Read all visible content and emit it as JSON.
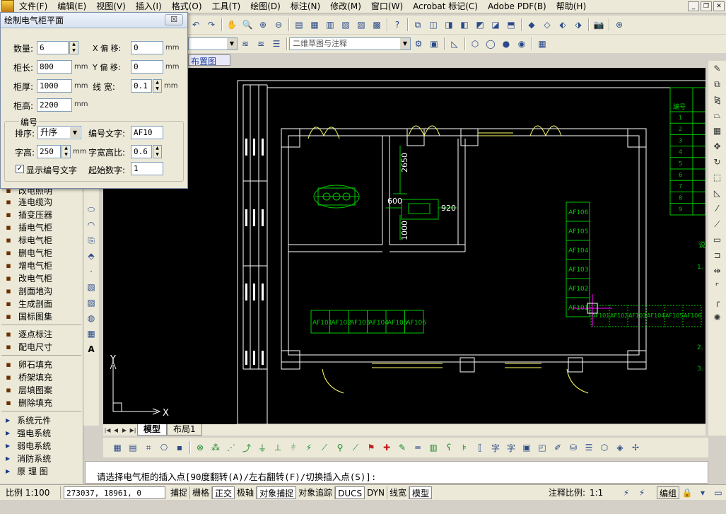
{
  "menu": [
    "文件(F)",
    "编辑(E)",
    "视图(V)",
    "插入(I)",
    "格式(O)",
    "工具(T)",
    "绘图(D)",
    "标注(N)",
    "修改(M)",
    "窗口(W)",
    "Acrobat 标记(C)",
    "Adobe PDF(B)",
    "帮助(H)"
  ],
  "toolbar": {
    "workspace_combo": "二维草图与注释",
    "layout_tab_hint": "布置图"
  },
  "dialog": {
    "title": "绘制电气柜平面",
    "close_label": "☒",
    "count_label": "数量:",
    "count_value": "6",
    "length_label": "柜长:",
    "length_value": "800",
    "thickness_label": "柜厚:",
    "thickness_value": "1000",
    "height_label": "柜高:",
    "height_value": "2200",
    "unit_mm": "mm",
    "x_offset_label": "X 偏 移:",
    "x_offset_value": "0",
    "y_offset_label": "Y 偏 移:",
    "y_offset_value": "0",
    "linewidth_label": "线 宽:",
    "linewidth_value": "0.1",
    "group_label": "编号",
    "sort_label": "排序:",
    "sort_value": "升序",
    "code_text_label": "编号文字:",
    "code_text_value": "AF10",
    "char_height_label": "字高:",
    "char_height_value": "250",
    "ratio_label": "字宽高比:",
    "ratio_value": "0.6",
    "show_code_label": "显示编号文字",
    "show_code_checked": true,
    "start_num_label": "起始数字:",
    "start_num_value": "1"
  },
  "left_panel": {
    "partial_top": "改电照明",
    "items": [
      {
        "label": "连电缆沟",
        "icon": "cable-trench-icon"
      },
      {
        "label": "插变压器",
        "icon": "transformer-icon"
      },
      {
        "label": "插电气柜",
        "icon": "cabinet-icon"
      },
      {
        "label": "标电气柜",
        "icon": "cabinet-label-icon"
      },
      {
        "label": "删电气柜",
        "icon": "cabinet-delete-icon"
      },
      {
        "label": "增电气柜",
        "icon": "cabinet-add-icon"
      },
      {
        "label": "改电气柜",
        "icon": "cabinet-edit-icon"
      },
      {
        "label": "剖面地沟",
        "icon": "trench-section-icon"
      },
      {
        "label": "生成剖面",
        "icon": "section-icon"
      },
      {
        "label": "国标图集",
        "icon": "atlas-icon"
      }
    ],
    "items2": [
      {
        "label": "逐点标注",
        "icon": "point-dim-icon"
      },
      {
        "label": "配电尺寸",
        "icon": "dist-dim-icon"
      }
    ],
    "items3": [
      {
        "label": "卵石填充",
        "icon": "pebble-fill-icon"
      },
      {
        "label": "桥架填充",
        "icon": "tray-fill-icon"
      },
      {
        "label": "层填图案",
        "icon": "layer-fill-icon"
      },
      {
        "label": "删除填充",
        "icon": "delete-fill-icon"
      }
    ],
    "categories": [
      "系统元件",
      "强电系统",
      "弱电系统",
      "消防系统",
      "原 理 图"
    ]
  },
  "drawing": {
    "dim_2650": "2650",
    "dim_600": "600",
    "dim_920": "920",
    "dim_1000": "1000",
    "row_cabinets": [
      "AF101",
      "AF102",
      "AF103",
      "AF104",
      "AF105",
      "AF106"
    ],
    "col_cabinets": [
      "AF106",
      "AF105",
      "AF104",
      "AF103",
      "AF102",
      "AF101"
    ],
    "preview_cabinets": [
      "AF101",
      "AF102",
      "AF103",
      "AF104",
      "AF105",
      "AF106"
    ],
    "table_header": "编号",
    "table_rows": [
      "1",
      "2",
      "3",
      "4",
      "5",
      "6",
      "7",
      "8",
      "9"
    ],
    "note_char": "说",
    "note_1": "1.",
    "note_2": "2.",
    "note_3": "3.",
    "ucs_x": "X",
    "ucs_y": "Y"
  },
  "layout_tabs": [
    "模型",
    "布局1"
  ],
  "command_line": "请选择电气柜的插入点[90度翻转(A)/左右翻转(F)/切换插入点(S)]:",
  "status": {
    "scale": "比例 1:100",
    "coords": "273037, 18961, 0",
    "toggles": [
      "捕捉",
      "栅格",
      "正交",
      "极轴",
      "对象捕捉",
      "对象追踪",
      "DUCS",
      "DYN",
      "线宽",
      "模型"
    ],
    "toggles_on": [
      "正交",
      "对象捕捉",
      "DUCS",
      "模型"
    ],
    "anno_scale_label": "注释比例:",
    "anno_scale_value": "1:1",
    "mode": "编组"
  },
  "colors": {
    "canvas": "#000000",
    "wall": "#ffffff",
    "cabinet": "#00c800",
    "door": "#ffff66",
    "cursor": "#ff00ff"
  }
}
